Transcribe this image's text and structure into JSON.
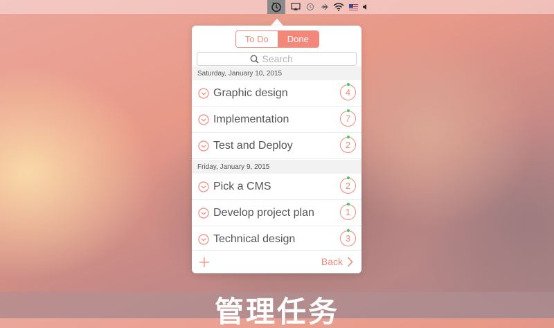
{
  "menubar": {
    "icons": [
      "timer-app-icon",
      "airplay-icon",
      "time-machine-icon",
      "bluetooth-icon",
      "wifi-icon",
      "us-flag-icon",
      "volume-icon"
    ]
  },
  "popover": {
    "tabs": {
      "todo": "To Do",
      "done": "Done",
      "active": "Done"
    },
    "search": {
      "placeholder": "Search"
    },
    "groups": [
      {
        "date": "Saturday, January 10, 2015",
        "tasks": [
          {
            "title": "Graphic design",
            "count": "4"
          },
          {
            "title": "Implementation",
            "count": "7"
          },
          {
            "title": "Test and Deploy",
            "count": "2"
          }
        ]
      },
      {
        "date": "Friday, January 9, 2015",
        "tasks": [
          {
            "title": "Pick a CMS",
            "count": "2"
          },
          {
            "title": "Develop project plan",
            "count": "1"
          },
          {
            "title": "Technical design",
            "count": "3"
          }
        ]
      }
    ],
    "footer": {
      "back_label": "Back"
    }
  },
  "caption": "管理任务",
  "colors": {
    "accent": "#f08a7a",
    "status_dot": "#42c95a"
  }
}
